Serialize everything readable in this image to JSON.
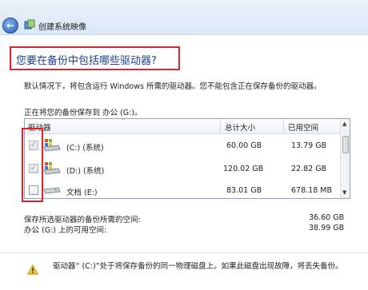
{
  "window": {
    "title": "创建系统映像"
  },
  "heading": "您要在备份中包括哪些驱动器?",
  "description": "默认情况下，将包含运行 Windows 所需的驱动器。您不能包含正在保存备份的驱动器。",
  "saving_to": "正在将您的备份保存到 办公 (G:)。",
  "table": {
    "columns": [
      "驱动器",
      "总计大小",
      "已用空间"
    ],
    "rows": [
      {
        "checked": true,
        "disabled": true,
        "drive": "(C:) (系统)",
        "total": "60.00 GB",
        "used": "13.79 GB"
      },
      {
        "checked": true,
        "disabled": true,
        "drive": "(D:) (系统)",
        "total": "120.02 GB",
        "used": "22.82 GB"
      },
      {
        "checked": false,
        "disabled": false,
        "drive": "文档 (E:)",
        "total": "83.01 GB",
        "used": "678.18 MB"
      }
    ]
  },
  "summary": {
    "required_label": "保存所选驱动器的备份所需的空间:",
    "required_value": "36.60 GB",
    "available_label": "办公 (G:) 上的可用空间:",
    "available_value": "38.99 GB"
  },
  "warning": "驱动器“ (C:)”处于将保存备份的同一物理磁盘上。如果此磁盘出现故障，将丢失备份。",
  "colors": {
    "heading": "#1b3e91",
    "highlight": "#e0242c",
    "titlebar": "#dbe7f6"
  },
  "icons": [
    "back-arrow-icon",
    "backup-app-icon",
    "drive-icon",
    "checkmark-icon",
    "warning-icon",
    "sort-arrow-icon"
  ]
}
